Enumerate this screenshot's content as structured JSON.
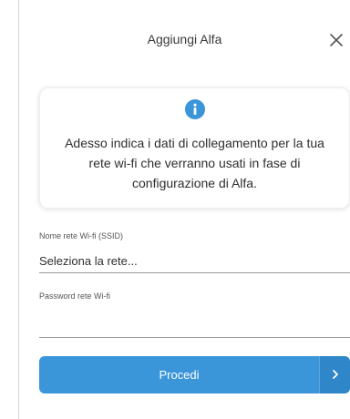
{
  "dialog": {
    "title": "Aggiungi Alfa"
  },
  "info": {
    "icon": "info-icon",
    "text": "Adesso indica i dati di collegamento per la tua rete wi-fi che verranno usati in fase di configurazione di Alfa."
  },
  "form": {
    "ssid_label": "Nome rete Wi-fi (SSID)",
    "ssid_value": "Seleziona la rete...",
    "password_label": "Password rete Wi-fi",
    "password_value": ""
  },
  "actions": {
    "proceed_label": "Procedi"
  },
  "colors": {
    "accent": "#3a95d9",
    "info_icon": "#3a95d9"
  }
}
